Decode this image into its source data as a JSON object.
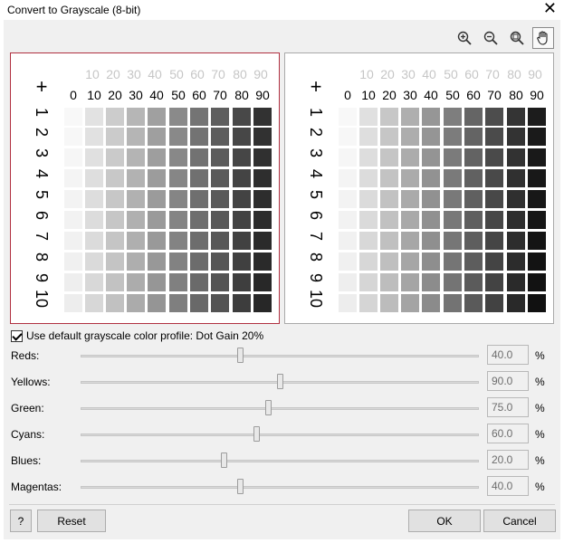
{
  "window": {
    "title": "Convert to Grayscale (8-bit)",
    "close_glyph": "✕"
  },
  "toolbar": {
    "icons": [
      "zoom-in-icon",
      "zoom-out-icon",
      "zoom-fit-icon",
      "hand-pan-icon"
    ],
    "active": "hand-pan-icon"
  },
  "preview": {
    "plus": "+",
    "top_labels_faded": [
      "10",
      "20",
      "30",
      "40",
      "50",
      "60",
      "70",
      "80",
      "90"
    ],
    "top_labels": [
      "0",
      "10",
      "20",
      "30",
      "40",
      "50",
      "60",
      "70",
      "80",
      "90"
    ],
    "row_labels": [
      "1",
      "2",
      "3",
      "4",
      "5",
      "6",
      "7",
      "8",
      "9",
      "10"
    ]
  },
  "profile": {
    "checked": true,
    "label": "Use default grayscale color profile: Dot Gain 20%"
  },
  "sliders": [
    {
      "label": "Reds:",
      "value": "40.0",
      "fraction": 0.4,
      "unit": "%"
    },
    {
      "label": "Yellows:",
      "value": "90.0",
      "fraction": 0.5,
      "unit": "%"
    },
    {
      "label": "Green:",
      "value": "75.0",
      "fraction": 0.47,
      "unit": "%"
    },
    {
      "label": "Cyans:",
      "value": "60.0",
      "fraction": 0.44,
      "unit": "%"
    },
    {
      "label": "Blues:",
      "value": "20.0",
      "fraction": 0.36,
      "unit": "%"
    },
    {
      "label": "Magentas:",
      "value": "40.0",
      "fraction": 0.4,
      "unit": "%"
    }
  ],
  "buttons": {
    "help": "?",
    "reset": "Reset",
    "ok": "OK",
    "cancel": "Cancel"
  }
}
